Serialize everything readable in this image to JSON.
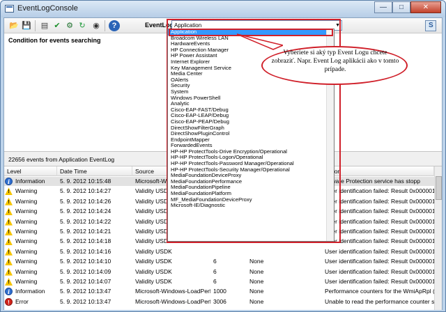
{
  "window": {
    "title": "EventLogConsole"
  },
  "toolbar": {
    "eventlog_label": "EventLog",
    "selected_log": "Application",
    "buttons": [
      "open-icon",
      "save-icon",
      "filter-icon",
      "check-icon",
      "export-icon",
      "refresh-icon",
      "search-icon",
      "help-icon"
    ]
  },
  "condition": {
    "label": "Condition for events searching"
  },
  "status": {
    "count_text": "22656 events from Application EventLog"
  },
  "dropdown": {
    "items": [
      "Application",
      "Broadcom Wireless LAN",
      "HardwareEvents",
      "HP Connection Manager",
      "HP Power Assistant",
      "Internet Explorer",
      "Key Management Service",
      "Media Center",
      "OAlerts",
      "Security",
      "System",
      "Windows PowerShell",
      "Analytic",
      "Cisco-EAP-FAST/Debug",
      "Cisco-EAP-LEAP/Debug",
      "Cisco-EAP-PEAP/Debug",
      "DirectShowFilterGraph",
      "DirectShowPluginControl",
      "EndpointMapper",
      "ForwardedEvents",
      "HP-HP ProtectTools-Drive Encryption/Operational",
      "HP-HP ProtectTools-Logon/Operational",
      "HP-HP ProtectTools-Password Manager/Operational",
      "HP-HP ProtectTools-Security Manager/Operational",
      "MediaFoundationDeviceProxy",
      "MediaFoundationPerformance",
      "MediaFoundationPipeline",
      "MediaFoundationPlatform",
      "MF_MediaFoundationDeviceProxy",
      "Microsoft-IE/Diagnostic"
    ]
  },
  "callout": {
    "text": "Vyberiete si aký typ Event Logu chcete zobraziť. Napr. Event Log aplikácii ako v tomto prípade."
  },
  "table": {
    "columns": [
      "Level",
      "Date Time",
      "Source",
      "",
      "",
      "ription"
    ],
    "rows": [
      {
        "level": "Information",
        "icon": "info",
        "datetime": "5. 9. 2012   10:15:48",
        "source": "Microsoft-Wind",
        "eventid": "",
        "category": "",
        "desc": "oftware Protection service has stopp"
      },
      {
        "level": "Warning",
        "icon": "warn",
        "datetime": "5. 9. 2012   10:14:27",
        "source": "Validity USDK",
        "eventid": "",
        "category": "",
        "desc": "User identification failed: Result 0x000001"
      },
      {
        "level": "Warning",
        "icon": "warn",
        "datetime": "5. 9. 2012   10:14:26",
        "source": "Validity USDK",
        "eventid": "",
        "category": "",
        "desc": "User identification failed: Result 0x000001"
      },
      {
        "level": "Warning",
        "icon": "warn",
        "datetime": "5. 9. 2012   10:14:24",
        "source": "Validity USDK",
        "eventid": "",
        "category": "",
        "desc": "User identification failed: Result 0x000001"
      },
      {
        "level": "Warning",
        "icon": "warn",
        "datetime": "5. 9. 2012   10:14:22",
        "source": "Validity USDK",
        "eventid": "",
        "category": "",
        "desc": "User identification failed: Result 0x000001"
      },
      {
        "level": "Warning",
        "icon": "warn",
        "datetime": "5. 9. 2012   10:14:21",
        "source": "Validity USDK",
        "eventid": "",
        "category": "",
        "desc": "User identification failed: Result 0x000001"
      },
      {
        "level": "Warning",
        "icon": "warn",
        "datetime": "5. 9. 2012   10:14:18",
        "source": "Validity USDK",
        "eventid": "",
        "category": "",
        "desc": "User identification failed: Result 0x000001"
      },
      {
        "level": "Warning",
        "icon": "warn",
        "datetime": "5. 9. 2012   10:14:16",
        "source": "Validity USDK",
        "eventid": "",
        "category": "",
        "desc": "User identification failed: Result 0x000001"
      },
      {
        "level": "Warning",
        "icon": "warn",
        "datetime": "5. 9. 2012   10:14:10",
        "source": "Validity USDK",
        "eventid": "6",
        "category": "None",
        "desc": "User identification failed: Result 0x000001"
      },
      {
        "level": "Warning",
        "icon": "warn",
        "datetime": "5. 9. 2012   10:14:09",
        "source": "Validity USDK",
        "eventid": "6",
        "category": "None",
        "desc": "User identification failed: Result 0x000001"
      },
      {
        "level": "Warning",
        "icon": "warn",
        "datetime": "5. 9. 2012   10:14:07",
        "source": "Validity USDK",
        "eventid": "6",
        "category": "None",
        "desc": "User identification failed: Result 0x000001"
      },
      {
        "level": "Information",
        "icon": "info",
        "datetime": "5. 9. 2012   10:13:47",
        "source": "Microsoft-Windows-LoadPerf",
        "eventid": "1000",
        "category": "None",
        "desc": "Performance counters for the WmiApRpl (W"
      },
      {
        "level": "Error",
        "icon": "err",
        "datetime": "5. 9. 2012   10:13:47",
        "source": "Microsoft-Windows-LoadPerf",
        "eventid": "3006",
        "category": "None",
        "desc": "Unable to read the performance counter s"
      }
    ]
  }
}
